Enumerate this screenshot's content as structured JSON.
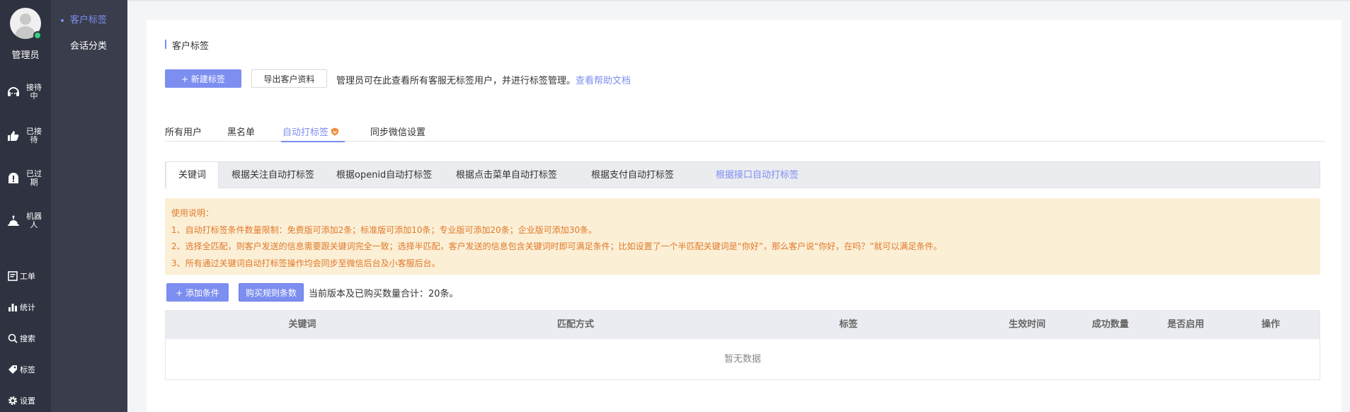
{
  "user": {
    "name": "管理员"
  },
  "rail": {
    "items": [
      {
        "label": "接待中",
        "icon": "headset-icon"
      },
      {
        "label": "已接待",
        "icon": "thumbs-up-icon"
      },
      {
        "label": "已过期",
        "icon": "clock-alert-icon"
      },
      {
        "label": "机器人",
        "icon": "robot-icon"
      }
    ],
    "tools": [
      {
        "label": "工单",
        "icon": "ticket-icon"
      },
      {
        "label": "统计",
        "icon": "bar-chart-icon"
      },
      {
        "label": "搜索",
        "icon": "search-icon"
      },
      {
        "label": "标签",
        "icon": "tag-icon"
      },
      {
        "label": "设置",
        "icon": "gear-icon"
      }
    ]
  },
  "subnav": {
    "items": [
      {
        "label": "客户标签",
        "active": true
      },
      {
        "label": "会话分类",
        "active": false
      }
    ]
  },
  "page": {
    "title": "客户标签",
    "new_tag_button": "+ 新建标签",
    "export_button": "导出客户资料",
    "help_text": "管理员可在此查看所有客服无标签用户，并进行标签管理。",
    "help_link": "查看帮助文档"
  },
  "tabs": [
    {
      "label": "所有用户"
    },
    {
      "label": "黑名单"
    },
    {
      "label": "自动打标签",
      "active": true,
      "badge_icon": "vip-icon"
    },
    {
      "label": "同步微信设置"
    }
  ],
  "subtabs": [
    {
      "label": "关键词",
      "active": true
    },
    {
      "label": "根据关注自动打标签"
    },
    {
      "label": "根据openid自动打标签"
    },
    {
      "label": "根据点击菜单自动打标签"
    },
    {
      "label": "根据支付自动打标签"
    },
    {
      "label": "根据接口自动打标签",
      "link": true
    }
  ],
  "notice": {
    "title": "使用说明：",
    "lines": [
      "1、自动打标签条件数量限制：免费版可添加2条；标准版可添加10条；专业版可添加20条；企业版可添加30条。",
      "2、选择全匹配，则客户发送的信息需要跟关键词完全一致；选择半匹配，客户发送的信息包含关键词时即可满足条件；比如设置了一个半匹配关键词是“你好”，那么客户说“你好，在吗？”就可以满足条件。",
      "3、所有通过关键词自动打标签操作均会同步至微信后台及小客服后台。"
    ]
  },
  "actions": {
    "add_condition": "+ 添加条件",
    "buy_rules": "购买规则条数",
    "count_text": "当前版本及已购买数量合计：20条。"
  },
  "table": {
    "headers": [
      "关键词",
      "匹配方式",
      "标签",
      "生效时间",
      "成功数量",
      "是否启用",
      "操作"
    ],
    "empty_text": "暂无数据"
  },
  "colors": {
    "accent": "#7c8ef0",
    "rail": "#2f3240",
    "subnav": "#3a3d4b",
    "notice_bg": "#fbefd6",
    "notice_text": "#e07a2a",
    "online": "#35d07f"
  }
}
